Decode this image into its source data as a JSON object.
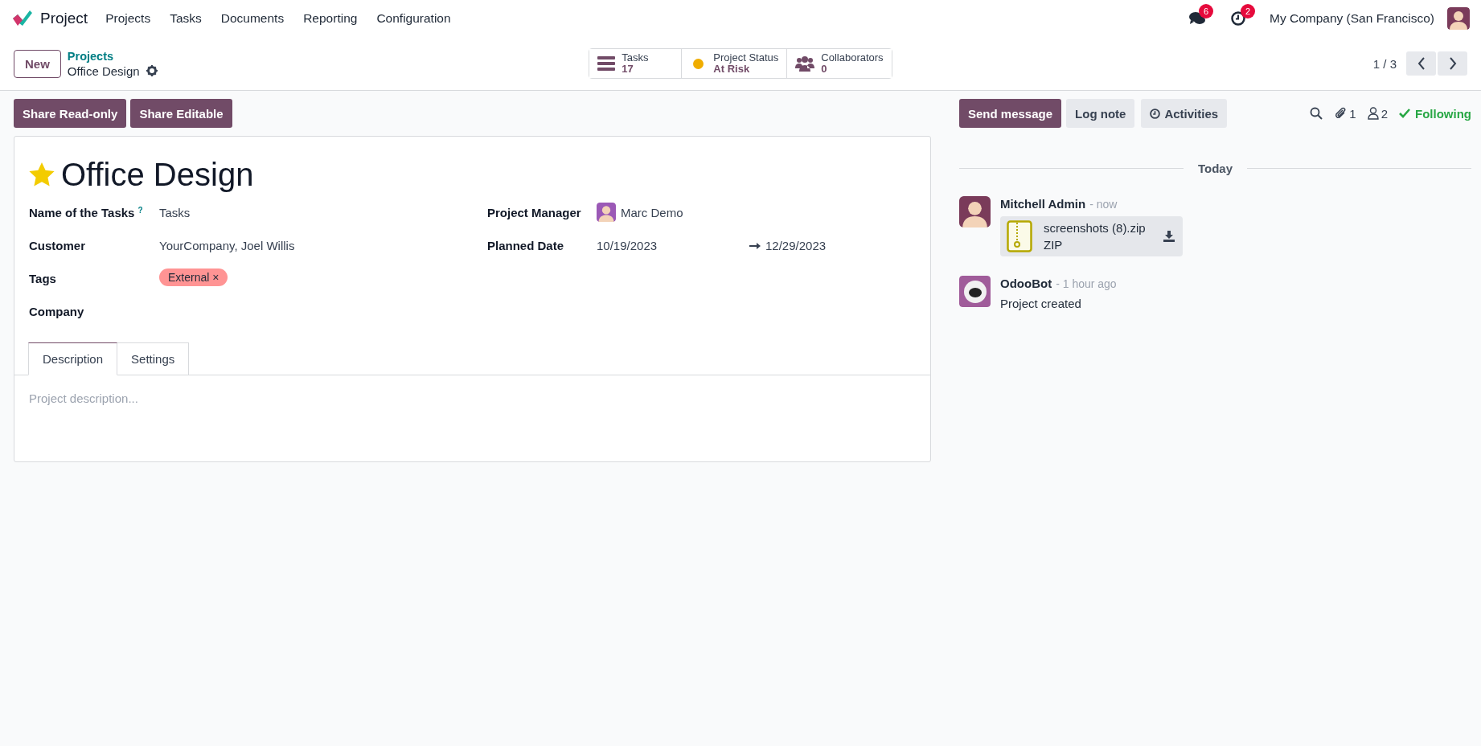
{
  "navbar": {
    "app_name": "Project",
    "menu": [
      "Projects",
      "Tasks",
      "Documents",
      "Reporting",
      "Configuration"
    ],
    "messages_badge": "6",
    "activities_badge": "2",
    "company": "My Company (San Francisco)"
  },
  "control_panel": {
    "new_button": "New",
    "breadcrumb": "Projects",
    "record_name": "Office Design",
    "pager": "1 / 3",
    "stat_buttons": [
      {
        "kind": "tasks",
        "label": "Tasks",
        "value": "17"
      },
      {
        "kind": "status",
        "label": "Project Status",
        "value": "At Risk",
        "color": "#f0ad00"
      },
      {
        "kind": "collaborators",
        "label": "Collaborators",
        "value": "0"
      }
    ]
  },
  "actions": [
    "Share Read-only",
    "Share Editable"
  ],
  "form": {
    "title": "Office Design",
    "favorite": true,
    "left_fields": [
      {
        "kind": "text",
        "label": "Name of the Tasks",
        "help": "?",
        "value": "Tasks"
      },
      {
        "kind": "text",
        "label": "Customer",
        "value": "YourCompany, Joel Willis"
      },
      {
        "kind": "tags",
        "label": "Tags",
        "tags": [
          {
            "label": "External",
            "remove": "×",
            "color": "#ff9494"
          }
        ]
      },
      {
        "kind": "text",
        "label": "Company"
      }
    ],
    "right_fields": [
      {
        "kind": "avatar",
        "label": "Project Manager",
        "value": "Marc Demo"
      },
      {
        "kind": "daterange",
        "label": "Planned Date",
        "start": "10/19/2023",
        "end": "12/29/2023"
      }
    ],
    "tabs": [
      {
        "label": "Description",
        "selected": true
      },
      {
        "label": "Settings",
        "selected": false
      }
    ],
    "description_placeholder": "Project description..."
  },
  "chatter": {
    "buttons": [
      {
        "kind": "primary",
        "label": "Send message"
      },
      {
        "kind": "secondary",
        "label": "Log note"
      },
      {
        "kind": "activity",
        "label": "Activities"
      }
    ],
    "attachments_count": "1",
    "followers_count": "2",
    "following": "Following",
    "date_separator": "Today",
    "messages": [
      {
        "author": "Mitchell Admin",
        "time": "- now",
        "kind": "person",
        "attachment": {
          "name": "screenshots (8).zip",
          "type": "ZIP"
        }
      },
      {
        "author": "OdooBot",
        "time": "- 1 hour ago",
        "kind": "bot",
        "body": "Project created"
      }
    ]
  }
}
